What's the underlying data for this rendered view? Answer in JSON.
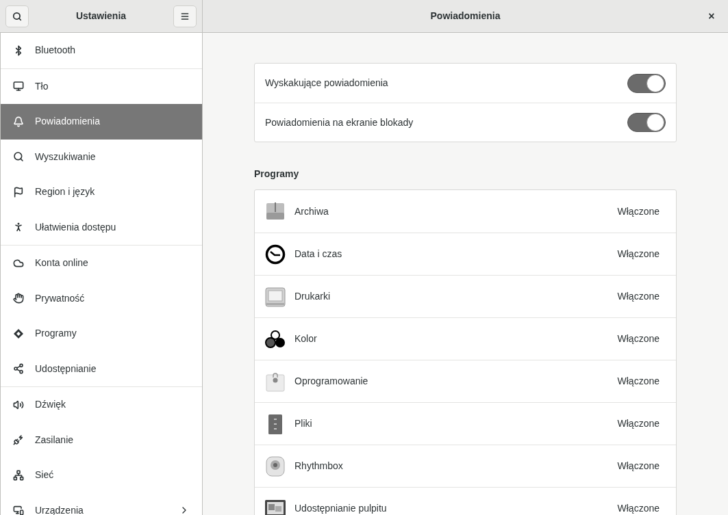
{
  "sidebar": {
    "title": "Ustawienia",
    "groups": [
      [
        {
          "label": "Bluetooth",
          "selected": false
        }
      ],
      [
        {
          "label": "Tło",
          "selected": false
        },
        {
          "label": "Powiadomienia",
          "selected": true
        },
        {
          "label": "Wyszukiwanie",
          "selected": false
        },
        {
          "label": "Region i język",
          "selected": false
        },
        {
          "label": "Ułatwienia dostępu",
          "selected": false
        }
      ],
      [
        {
          "label": "Konta online",
          "selected": false
        },
        {
          "label": "Prywatność",
          "selected": false
        },
        {
          "label": "Programy",
          "selected": false
        },
        {
          "label": "Udostępnianie",
          "selected": false
        }
      ],
      [
        {
          "label": "Dźwięk",
          "selected": false
        },
        {
          "label": "Zasilanie",
          "selected": false
        },
        {
          "label": "Sieć",
          "selected": false
        },
        {
          "label": "Urządzenia",
          "selected": false,
          "has_submenu": true
        }
      ]
    ]
  },
  "main": {
    "title": "Powiadomienia",
    "close": "×",
    "switches": [
      {
        "label": "Wyskakujące powiadomienia",
        "on": true
      },
      {
        "label": "Powiadomienia na ekranie blokady",
        "on": true
      }
    ],
    "apps_heading": "Programy",
    "apps": [
      {
        "name": "Archiwa",
        "status": "Włączone"
      },
      {
        "name": "Data i czas",
        "status": "Włączone"
      },
      {
        "name": "Drukarki",
        "status": "Włączone"
      },
      {
        "name": "Kolor",
        "status": "Włączone"
      },
      {
        "name": "Oprogramowanie",
        "status": "Włączone"
      },
      {
        "name": "Pliki",
        "status": "Włączone"
      },
      {
        "name": "Rhythmbox",
        "status": "Włączone"
      },
      {
        "name": "Udostępnianie pulpitu",
        "status": "Włączone"
      }
    ]
  }
}
